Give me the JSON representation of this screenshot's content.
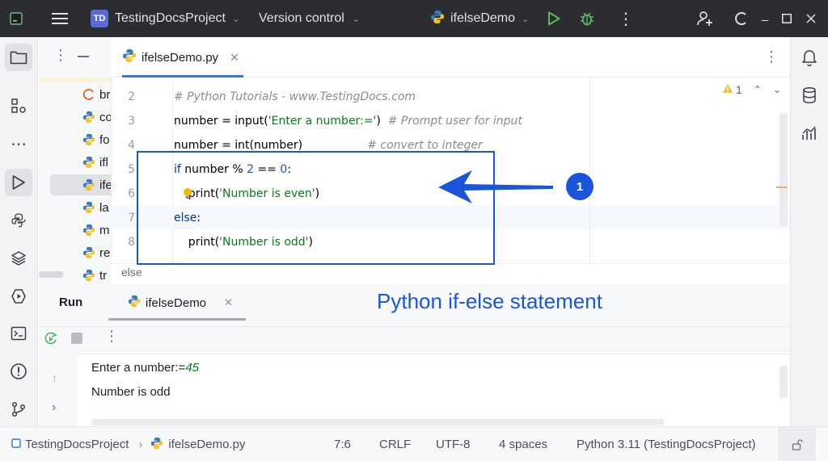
{
  "titlebar": {
    "project_initials": "TD",
    "project_name": "TestingDocsProject",
    "vcs_label": "Version control",
    "run_config": "ifelseDemo"
  },
  "project_tree": {
    "items": [
      {
        "label": "br",
        "icon": "jupyter-icon"
      },
      {
        "label": "co",
        "icon": "python-file-icon"
      },
      {
        "label": "fo",
        "icon": "python-file-icon"
      },
      {
        "label": "ifl",
        "icon": "python-file-icon"
      },
      {
        "label": "ife",
        "icon": "python-file-icon"
      },
      {
        "label": "la",
        "icon": "python-file-icon"
      },
      {
        "label": "m",
        "icon": "python-file-icon"
      },
      {
        "label": "re",
        "icon": "python-file-icon"
      },
      {
        "label": "tr",
        "icon": "python-file-icon"
      }
    ]
  },
  "editor": {
    "tab_label": "ifelseDemo.py",
    "warning_count": "1",
    "breadcrumb": "else",
    "lines": [
      {
        "n": "2",
        "tokens": [
          {
            "t": "# Python Tutorials - www.TestingDocs.com",
            "c": "cmt"
          }
        ]
      },
      {
        "n": "3",
        "tokens": [
          {
            "t": "number = ",
            "c": "call"
          },
          {
            "t": "input(",
            "c": "call"
          },
          {
            "t": "'Enter a number:='",
            "c": "str"
          },
          {
            "t": ")  ",
            "c": "call"
          },
          {
            "t": "# Prompt user for input",
            "c": "cmt"
          }
        ]
      },
      {
        "n": "4",
        "tokens": [
          {
            "t": "number = ",
            "c": "call"
          },
          {
            "t": "int(number)",
            "c": "call"
          },
          {
            "t": "                  ",
            "c": "call"
          },
          {
            "t": "# convert to integer",
            "c": "cmt"
          }
        ]
      },
      {
        "n": "5",
        "tokens": [
          {
            "t": "if",
            "c": "kw"
          },
          {
            "t": " number % ",
            "c": "call"
          },
          {
            "t": "2",
            "c": "num"
          },
          {
            "t": " == ",
            "c": "call"
          },
          {
            "t": "0",
            "c": "num"
          },
          {
            "t": ":",
            "c": "call"
          }
        ]
      },
      {
        "n": "6",
        "tokens": [
          {
            "t": "    print(",
            "c": "call"
          },
          {
            "t": "'Number is even'",
            "c": "str"
          },
          {
            "t": ")",
            "c": "call"
          }
        ]
      },
      {
        "n": "7",
        "tokens": [
          {
            "t": "else",
            "c": "kw"
          },
          {
            "t": ":",
            "c": "call"
          }
        ]
      },
      {
        "n": "8",
        "tokens": [
          {
            "t": "    print(",
            "c": "call"
          },
          {
            "t": "'Number is odd'",
            "c": "str"
          },
          {
            "t": ")",
            "c": "call"
          }
        ]
      }
    ]
  },
  "annotation": {
    "badge_number": "1",
    "caption": "Python if-else statement",
    "color": "#1a56db"
  },
  "run": {
    "title": "Run",
    "tab_label": "ifelseDemo",
    "console_prompt": "Enter a number:=",
    "console_input": "45",
    "console_output": "Number is odd"
  },
  "statusbar": {
    "project": "TestingDocsProject",
    "file": "ifelseDemo.py",
    "position": "7:6",
    "line_sep": "CRLF",
    "encoding": "UTF-8",
    "indent": "4 spaces",
    "interpreter": "Python 3.11 (TestingDocsProject)"
  },
  "colors": {
    "titlebar_bg": "#2b2d30",
    "run_green": "#5fb85f",
    "keyword": "#0033b3",
    "string": "#067d17",
    "number": "#1750eb",
    "comment": "#8c8c8c"
  }
}
